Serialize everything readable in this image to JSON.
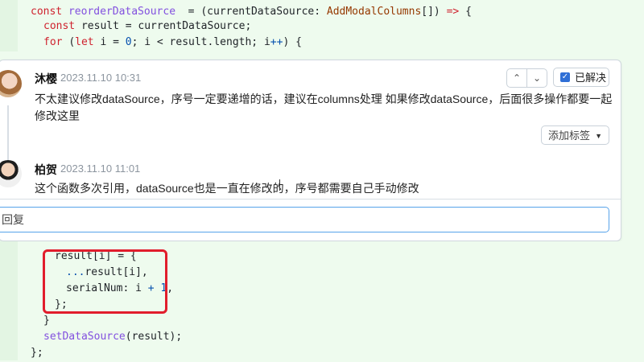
{
  "code_top": {
    "lines": [
      {
        "tokens": [
          [
            "kw",
            "const "
          ],
          [
            "fn",
            "reorderDataSource"
          ],
          [
            "",
            "  = (currentDataSource: "
          ],
          [
            "ty",
            "AddModalColumns"
          ],
          [
            "",
            "[]) "
          ],
          [
            "kw",
            "=>"
          ],
          [
            "",
            " {"
          ]
        ]
      },
      {
        "tokens": [
          [
            "kw",
            "const "
          ],
          [
            "",
            "result = currentDataSource;"
          ]
        ]
      },
      {
        "tokens": [
          [
            "kw",
            "for "
          ],
          [
            "",
            "("
          ],
          [
            "kw",
            "let "
          ],
          [
            "",
            "i = "
          ],
          [
            "num",
            "0"
          ],
          [
            "",
            "; i < result.length; i"
          ],
          [
            "op",
            "++"
          ],
          [
            "",
            ") {"
          ]
        ]
      }
    ]
  },
  "comments": [
    {
      "author": "沐樱",
      "time": "2023.11.10 10:31",
      "body": "不太建议修改dataSource，序号一定要递增的话，建议在columns处理 如果修改dataSource，后面很多操作都要一起修改这里"
    },
    {
      "author": "柏贺",
      "time": "2023.11.10 11:01",
      "body": "这个函数多次引用，dataSource也是一直在修改的，序号都需要自己手动修改"
    }
  ],
  "controls": {
    "prev_icon": "chevron-up-icon",
    "next_icon": "chevron-down-icon",
    "resolved_label": "已解决",
    "resolved_checked": true,
    "tag_label": "添加标签",
    "reply_placeholder": "回复"
  },
  "code_bottom": {
    "lines": [
      {
        "tokens": [
          [
            "",
            "result[i] = {"
          ]
        ]
      },
      {
        "tokens": [
          [
            "op",
            "..."
          ],
          [
            "",
            "result[i],"
          ]
        ]
      },
      {
        "tokens": [
          [
            "",
            "serialNum: i "
          ],
          [
            "op",
            "+ "
          ],
          [
            "num",
            "1"
          ],
          [
            "",
            ","
          ]
        ]
      },
      {
        "tokens": [
          [
            "",
            "};"
          ]
        ]
      },
      {
        "tokens": [
          [
            "",
            "}"
          ]
        ]
      },
      {
        "tokens": [
          [
            "fn",
            "setDataSource"
          ],
          [
            "",
            "(result);"
          ]
        ]
      },
      {
        "tokens": [
          [
            "",
            "};"
          ]
        ]
      }
    ]
  },
  "colors": {
    "accent": "#2f6fd6",
    "highlight_box": "#e11d2c",
    "diff_bg": "#eefbee"
  }
}
